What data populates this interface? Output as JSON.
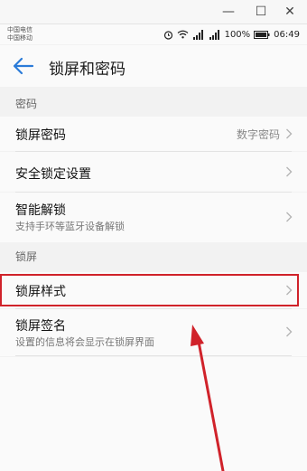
{
  "window": {
    "minimize_glyph": "—",
    "maximize_glyph": "☐",
    "close_glyph": "✕"
  },
  "status_bar": {
    "carrier_1": "中国电信",
    "carrier_2": "中国移动",
    "battery": "100%",
    "time": "06:49"
  },
  "app_bar": {
    "title": "锁屏和密码"
  },
  "sections": {
    "password": {
      "header": "密码",
      "items": [
        {
          "title": "锁屏密码",
          "value": "数字密码"
        },
        {
          "title": "安全锁定设置"
        },
        {
          "title": "智能解锁",
          "subtitle": "支持手环等蓝牙设备解锁"
        }
      ]
    },
    "lock_screen": {
      "header": "锁屏",
      "items": [
        {
          "title": "锁屏样式"
        },
        {
          "title": "锁屏签名",
          "subtitle": "设置的信息将会显示在锁屏界面"
        }
      ]
    }
  },
  "annotation_color": "#d0222a"
}
